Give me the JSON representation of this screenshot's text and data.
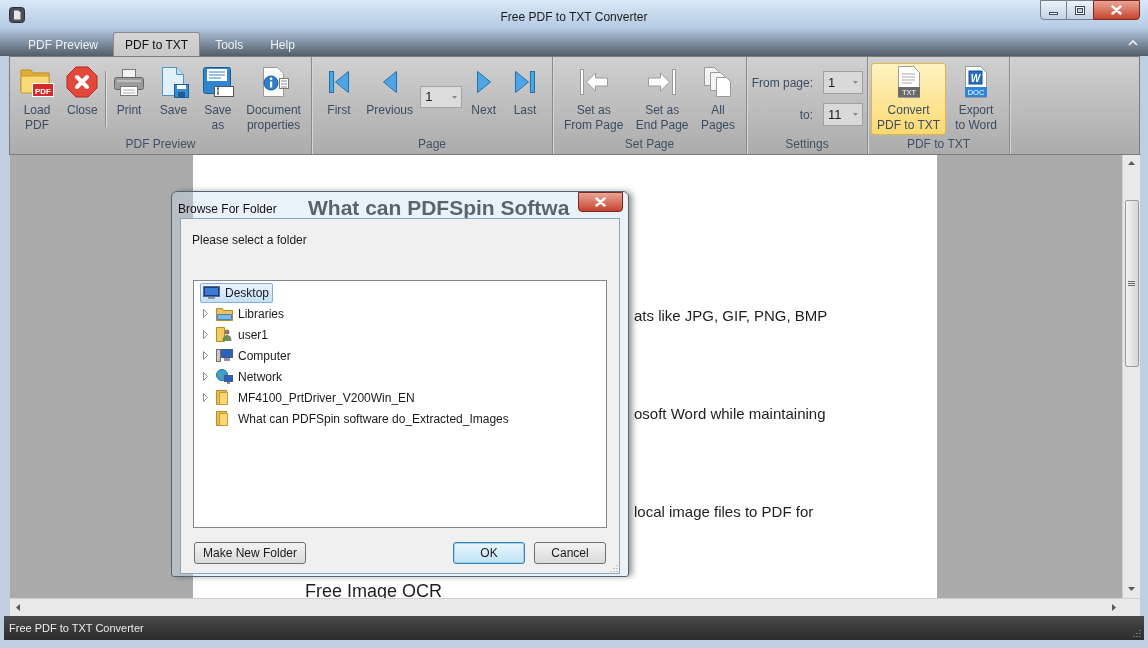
{
  "window": {
    "title": "Free PDF to TXT Converter"
  },
  "tabs": [
    {
      "label": "PDF Preview",
      "selected": false
    },
    {
      "label": "PDF to TXT",
      "selected": true
    },
    {
      "label": "Tools",
      "selected": false
    },
    {
      "label": "Help",
      "selected": false
    }
  ],
  "ribbon": [
    {
      "label": "PDF Preview",
      "items": [
        {
          "kind": "button",
          "label": "Load\nPDF",
          "badge": "PDF",
          "highlighted": false
        },
        {
          "kind": "button",
          "label": "Close",
          "highlighted": false
        },
        {
          "kind": "separator"
        },
        {
          "kind": "button",
          "label": "Print",
          "highlighted": false
        },
        {
          "kind": "button",
          "label": "Save",
          "highlighted": false
        },
        {
          "kind": "button",
          "label": "Save\nas",
          "highlighted": false
        },
        {
          "kind": "button",
          "label": "Document\nproperties",
          "highlighted": false
        }
      ]
    },
    {
      "label": "Page",
      "items": [
        {
          "kind": "button",
          "label": "First",
          "highlighted": false
        },
        {
          "kind": "button",
          "label": "Previous",
          "highlighted": false
        },
        {
          "kind": "combo",
          "value": "1"
        },
        {
          "kind": "button",
          "label": "Next",
          "highlighted": false
        },
        {
          "kind": "button",
          "label": "Last",
          "highlighted": false
        }
      ]
    },
    {
      "label": "Set Page",
      "items": [
        {
          "kind": "button",
          "label": "Set as\nFrom Page",
          "highlighted": false
        },
        {
          "kind": "button",
          "label": "Set as\nEnd Page",
          "highlighted": false
        },
        {
          "kind": "button",
          "label": "All\nPages",
          "highlighted": false
        }
      ]
    },
    {
      "label": "Settings",
      "items": [
        {
          "kind": "field",
          "label": "From page:",
          "value": "1"
        },
        {
          "kind": "field",
          "label": "to:",
          "value": "11"
        }
      ]
    },
    {
      "label": "PDF to TXT",
      "items": [
        {
          "kind": "button",
          "label": "Convert\nPDF to TXT",
          "badge": "TXT",
          "highlighted": true
        },
        {
          "kind": "button",
          "label": "Export\nto Word",
          "badge": "DOC",
          "logo_letter": "W",
          "highlighted": false
        }
      ]
    }
  ],
  "document": {
    "heading": "What can PDFSpin Softwa",
    "lines": [
      "ats like JPG, GIF, PNG, BMP",
      "osoft Word while maintaining",
      "local image files to PDF for"
    ],
    "subheading": "Free Image OCR"
  },
  "dialog": {
    "title": "Browse For Folder",
    "prompt": "Please select a folder",
    "tree": [
      {
        "label": "Desktop",
        "kind": "desktop",
        "selected": true,
        "expandable": false,
        "children": [
          {
            "label": "Libraries",
            "kind": "library",
            "selected": false,
            "expandable": true
          },
          {
            "label": "user1",
            "kind": "user",
            "selected": false,
            "expandable": true
          },
          {
            "label": "Computer",
            "kind": "computer",
            "selected": false,
            "expandable": true
          },
          {
            "label": "Network",
            "kind": "network",
            "selected": false,
            "expandable": true
          },
          {
            "label": "MF4100_PrtDriver_V200Win_EN",
            "kind": "folder",
            "selected": false,
            "expandable": true
          },
          {
            "label": "What can PDFSpin software do_Extracted_Images",
            "kind": "folder",
            "selected": false,
            "expandable": false
          }
        ]
      }
    ],
    "buttons": [
      {
        "label": "Make New Folder",
        "default": false
      },
      {
        "label": "OK",
        "default": true
      },
      {
        "label": "Cancel",
        "default": false
      }
    ]
  },
  "status_bar": {
    "text": "Free PDF to TXT Converter"
  }
}
